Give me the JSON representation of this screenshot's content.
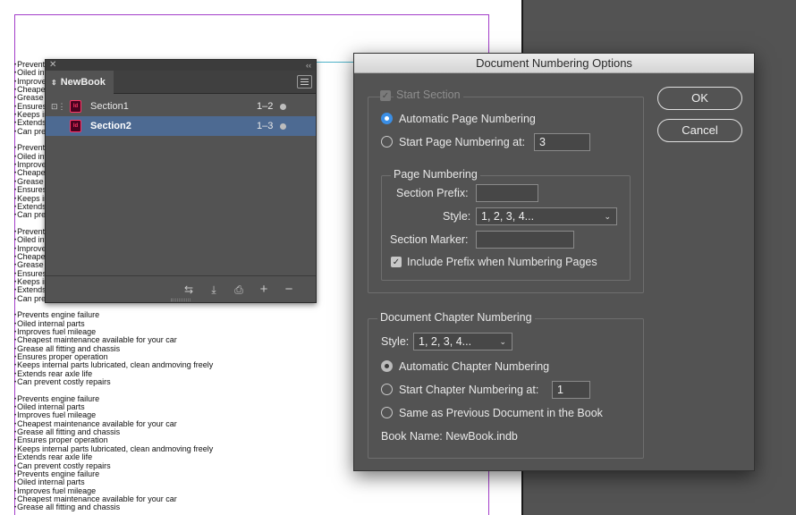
{
  "page": {
    "bullets_block_1": [
      "Prevents engine failure",
      "Oiled internal parts",
      "Improves fuel mileage",
      "Cheapest maintenance available for your car",
      "Grease all fitting and chassis",
      "Ensures proper operation",
      "Keeps internal parts lubricated, clean andmoving freely",
      "Extends rear axle life",
      "Can prevent costly repairs"
    ],
    "bullets_block_5": [
      "Prevents engine failure",
      "Oiled internal parts",
      "Improves fuel mileage",
      "Cheapest maintenance available for your car",
      "Grease all fitting and chassis"
    ]
  },
  "book_panel": {
    "tab_label": "NewBook",
    "rows": [
      {
        "name": "Section1",
        "pages": "1–2"
      },
      {
        "name": "Section2",
        "pages": "1–3"
      }
    ],
    "icon_text": "Id"
  },
  "dialog": {
    "title": "Document Numbering Options",
    "start_section": "Start Section",
    "automatic_page_numbering": "Automatic Page Numbering",
    "start_page_numbering_at": "Start Page Numbering at:",
    "start_page_value": "3",
    "page_numbering_group": "Page Numbering",
    "section_prefix_label": "Section Prefix:",
    "section_prefix_value": "",
    "style_label": "Style:",
    "page_style_value": "1, 2, 3, 4...",
    "section_marker_label": "Section Marker:",
    "section_marker_value": "",
    "include_prefix": "Include Prefix when Numbering Pages",
    "chapter_group": "Document Chapter Numbering",
    "chapter_style_value": "1, 2, 3, 4...",
    "automatic_chapter_numbering": "Automatic Chapter Numbering",
    "start_chapter_numbering_at": "Start Chapter Numbering at:",
    "start_chapter_value": "1",
    "same_as_previous": "Same as Previous Document in the Book",
    "book_name": "Book Name: NewBook.indb",
    "ok": "OK",
    "cancel": "Cancel"
  }
}
